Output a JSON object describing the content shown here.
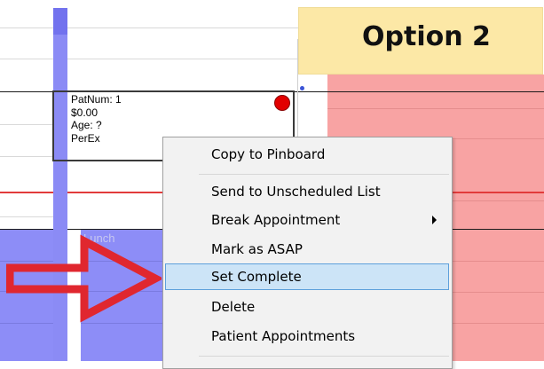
{
  "appointment": {
    "patnum": "PatNum: 1",
    "fee": "$0.00",
    "age": "Age: ?",
    "procedure": "PerEx"
  },
  "block_label": "Lunch",
  "option_label": "Option 2",
  "context_menu": {
    "items": [
      {
        "label": "Copy to Pinboard"
      },
      {
        "label": "Send to Unscheduled List"
      },
      {
        "label": "Break Appointment"
      },
      {
        "label": "Mark as ASAP"
      },
      {
        "label": "Set Complete"
      },
      {
        "label": "Delete"
      },
      {
        "label": "Patient Appointments"
      }
    ],
    "highlighted_item": "Set Complete"
  },
  "colors": {
    "provider_bar": "#8b8bf5",
    "blocked_time": "#8d8df7",
    "operatory_pink": "#f8a3a3",
    "time_indicator": "#e23b3b",
    "status_dot": "#e20000",
    "callout": "#fce8a6",
    "arrow": "#e0272f"
  },
  "icons": {
    "arrow": "red-outline-right-arrow-icon",
    "status": "red-dot-icon",
    "submenu": "triangle-right-icon"
  }
}
